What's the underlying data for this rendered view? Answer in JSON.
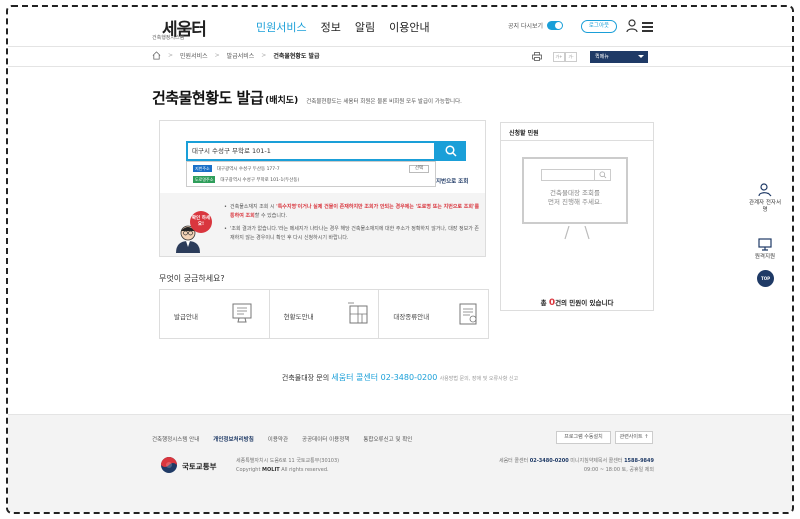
{
  "header": {
    "logo_text": "세움터",
    "logo_sub": "건축행정시스템",
    "nav": [
      "민원서비스",
      "정보",
      "알림",
      "이용안내"
    ],
    "notice_toggle_label": "공지 다시보기",
    "notice_toggle_state": "ON",
    "login_label": "로그아웃",
    "accent_color": "#1a9fd8"
  },
  "breadcrumb": {
    "items": [
      "민원서비스",
      "발급서비스",
      "건축물현황도 발급"
    ],
    "font_small": "가-",
    "font_large": "가+",
    "quick_menu": "퀵메뉴"
  },
  "page": {
    "title": "건축물현황도 발급",
    "title_sub": "(배치도)",
    "description": "건축물현황도는 세움터 회원은 물론 비회원 모두 발급이 가능합니다."
  },
  "search": {
    "value": "대구시 수성구 무학로 101-1",
    "results": [
      {
        "badge": "지번주소",
        "text": "대구광역시 수성구 두산동 177-7"
      },
      {
        "badge": "도로명주소",
        "text": "대구광역시 수성구 무학로 101-1(두산동)"
      }
    ],
    "select_label": "선택",
    "lot_link": "지번으로 조회"
  },
  "notice": {
    "bubble": "확인 하세요!",
    "line1_pre": "건축물소재지 조회 시 ",
    "line1_red": "'특수지명'이거나 실제 건물이 존재하지만 조회가 안되는 경우에는 '도로명 또는 지번으로 조회'를 통하여 조회",
    "line1_post": "할 수 있습니다.",
    "line2": "'조회 결과가 없습니다.'라는 메세지가 나타나는 경우 해당 건축물소재지에 대한 주소가 정확하지 않거나, 대장 정보가 존재하지 않는 경우이니 확인 후 다시 신청하시기 바랍니다."
  },
  "request_panel": {
    "title": "신청할 민원",
    "empty_line1": "건축물대장 조회를",
    "empty_line2": "먼저 진행해 주세요.",
    "count_pre": "총 ",
    "count": "0",
    "count_post": "건의 민원이 있습니다"
  },
  "question": "무엇이 궁금하세요?",
  "guides": [
    "발급안내",
    "현황도안내",
    "대장종류안내"
  ],
  "callcenter": {
    "pre": "건축물대장 문의 ",
    "name": "세움터 콜센터 02-3480-0200",
    "note": "사용방법 문의, 장애 및 오류사항 신고"
  },
  "footer": {
    "links": [
      "건축행정시스템 안내",
      "개인정보처리방침",
      "이용약관",
      "공공데이터 이용정책",
      "통합오류신고 및 확인"
    ],
    "btn_program": "프로그램 수동설치",
    "btn_related": "관련사이트",
    "org": "국토교통부",
    "address": "세종특별자치시 도움6로 11 국토교통부(30103)",
    "copyright_pre": "Copyright ",
    "copyright_b": "MOLIT",
    "copyright_post": " All rights reserved.",
    "contact_pre": "세움터 콜센터 ",
    "contact_num": "02-3480-0200",
    "contact_mid": "  미니지침약제목서 콜센터 ",
    "contact_num2": "1588-9849",
    "hours": "09:00 ~ 18:00 토, 공휴일 제외"
  },
  "floating": {
    "item1": "관계자 전자서명",
    "item2": "원격지원",
    "top": "TOP"
  }
}
